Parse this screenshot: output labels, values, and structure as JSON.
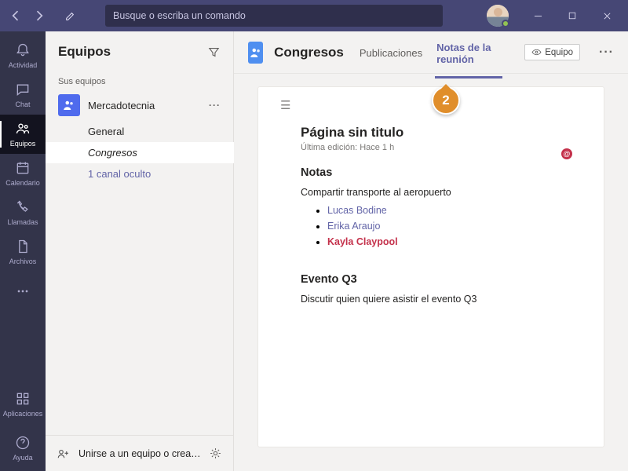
{
  "titlebar": {
    "search_placeholder": "Busque o escriba un comando"
  },
  "rail": {
    "activity": "Actividad",
    "chat": "Chat",
    "teams": "Equipos",
    "calendar": "Calendario",
    "calls": "Llamadas",
    "files": "Archivos",
    "apps": "Aplicaciones",
    "help": "Ayuda"
  },
  "leftpanel": {
    "title": "Equipos",
    "your_teams": "Sus equipos",
    "team_name": "Mercadotecnia",
    "channels": {
      "general": "General",
      "congresos": "Congresos",
      "hidden": "1 canal oculto"
    },
    "join": "Unirse a un equipo o crea…"
  },
  "main": {
    "channel_title": "Congresos",
    "tabs": {
      "posts": "Publicaciones",
      "notes": "Notas de la reunión"
    },
    "team_button": "Equipo"
  },
  "doc": {
    "title": "Página sin titulo",
    "last_edited": "Última edición: Hace 1 h",
    "section1_heading": "Notas",
    "section1_text": "Compartir transporte al aeropuerto",
    "mentions": {
      "m1": "Lucas Bodine",
      "m2": "Erika Araujo",
      "m3": "Kayla Claypool"
    },
    "section2_heading": "Evento Q3",
    "section2_text": "Discutir quien quiere asistir el evento Q3",
    "at_badge": "@"
  },
  "callout": {
    "number": "2"
  }
}
